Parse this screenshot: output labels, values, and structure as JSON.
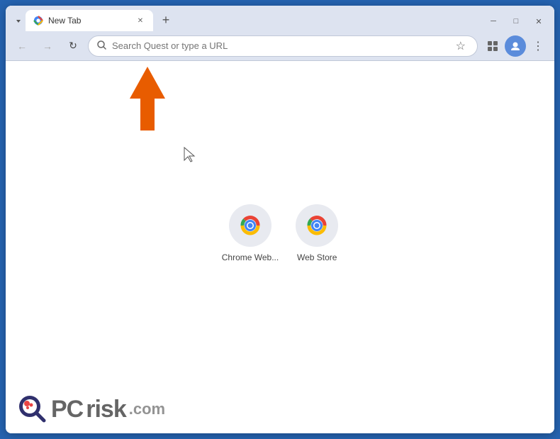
{
  "browser": {
    "title": "New Tab",
    "tab_label": "New Tab",
    "address_placeholder": "Search Quest or type a URL",
    "address_value": ""
  },
  "shortcuts": [
    {
      "label": "Chrome Web...",
      "icon": "chrome-web-store-icon"
    },
    {
      "label": "Web Store",
      "icon": "web-store-icon"
    }
  ],
  "watermark": {
    "pc_text": "PC",
    "risk_text": "risk",
    "com_text": ".com"
  },
  "toolbar": {
    "back_label": "←",
    "forward_label": "→",
    "reload_label": "↻",
    "bookmark_label": "☆",
    "extensions_label": "🧩",
    "menu_label": "⋮"
  },
  "window_controls": {
    "minimize": "─",
    "maximize": "□",
    "close": "✕"
  }
}
